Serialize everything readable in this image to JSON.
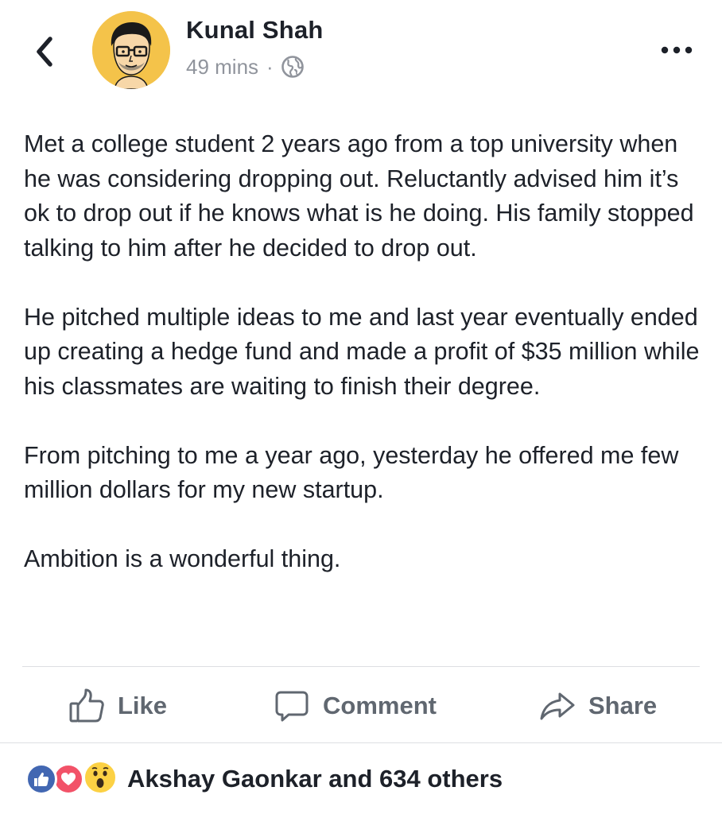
{
  "header": {
    "back_icon": "chevron-left-icon",
    "author_name": "Kunal Shah",
    "time": "49 mins",
    "separator": "·",
    "privacy_icon": "globe-icon",
    "more_icon": "more-horizontal-icon"
  },
  "post": {
    "paragraphs": [
      "Met a college student 2 years ago from a top university when he was considering dropping out. Reluctantly advised him it’s ok to drop out if he knows what is he doing. His family stopped talking to him after he decided to drop out.",
      "He pitched multiple ideas to me and last year eventually ended up creating a hedge fund and made a profit of $35 million while his classmates are waiting to finish their degree.",
      "From pitching to me a year ago, yesterday he offered me few million dollars for my new startup.",
      "Ambition is a wonderful thing."
    ]
  },
  "actions": {
    "like_label": "Like",
    "comment_label": "Comment",
    "share_label": "Share"
  },
  "reactions": {
    "icons": [
      "like-reaction-icon",
      "love-reaction-icon",
      "wow-reaction-icon"
    ],
    "summary": "Akshay Gaonkar and 634 others"
  },
  "colors": {
    "text": "#1d2129",
    "secondary": "#90949c",
    "action": "#606770",
    "divider": "#dddfe2",
    "avatar_bg": "#f4c34a",
    "like_blue": "#4267b2",
    "love_red": "#f25268",
    "wow_yellow": "#fcd144"
  }
}
